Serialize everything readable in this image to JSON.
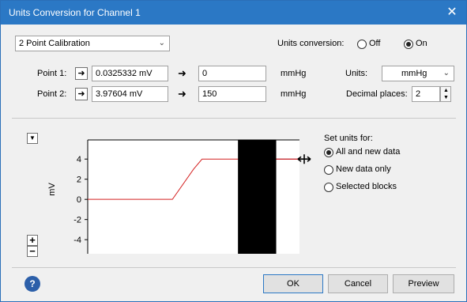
{
  "window": {
    "title": "Units Conversion for Channel 1",
    "close_glyph": "✕"
  },
  "mode": {
    "selected": "2 Point Calibration"
  },
  "units_conversion": {
    "label": "Units conversion:",
    "off_label": "Off",
    "on_label": "On",
    "selected": "On"
  },
  "points": [
    {
      "label": "Point 1:",
      "value": "0.0325332 mV",
      "converted": "0",
      "unit": "mmHg"
    },
    {
      "label": "Point 2:",
      "value": "3.97604 mV",
      "converted": "150",
      "unit": "mmHg"
    }
  ],
  "units": {
    "label": "Units:",
    "value": "mmHg"
  },
  "decimal_places": {
    "label": "Decimal places:",
    "value": "2"
  },
  "chart_data": {
    "type": "line",
    "ylabel": "mV",
    "yticks": [
      "4",
      "2",
      "0",
      "-2",
      "-4"
    ],
    "ylim": [
      -5.4,
      5.9
    ],
    "series": [
      {
        "color": "#d42020",
        "x": [
          0,
          0.4,
          0.5,
          0.54,
          1.0
        ],
        "y": [
          0,
          0,
          3,
          4,
          4
        ]
      }
    ],
    "selected_block": {
      "x_start": 0.71,
      "x_end": 0.89
    },
    "cursor_level": 4
  },
  "set_units": {
    "label": "Set units for:",
    "options": [
      "All and new data",
      "New data only",
      "Selected blocks"
    ],
    "selected": "All and new data"
  },
  "buttons": {
    "ok": "OK",
    "cancel": "Cancel",
    "preview": "Preview",
    "help": "?"
  },
  "colors": {
    "titlebar": "#2b78c5",
    "trace": "#d42020",
    "cursor": "#3aa0e0"
  }
}
